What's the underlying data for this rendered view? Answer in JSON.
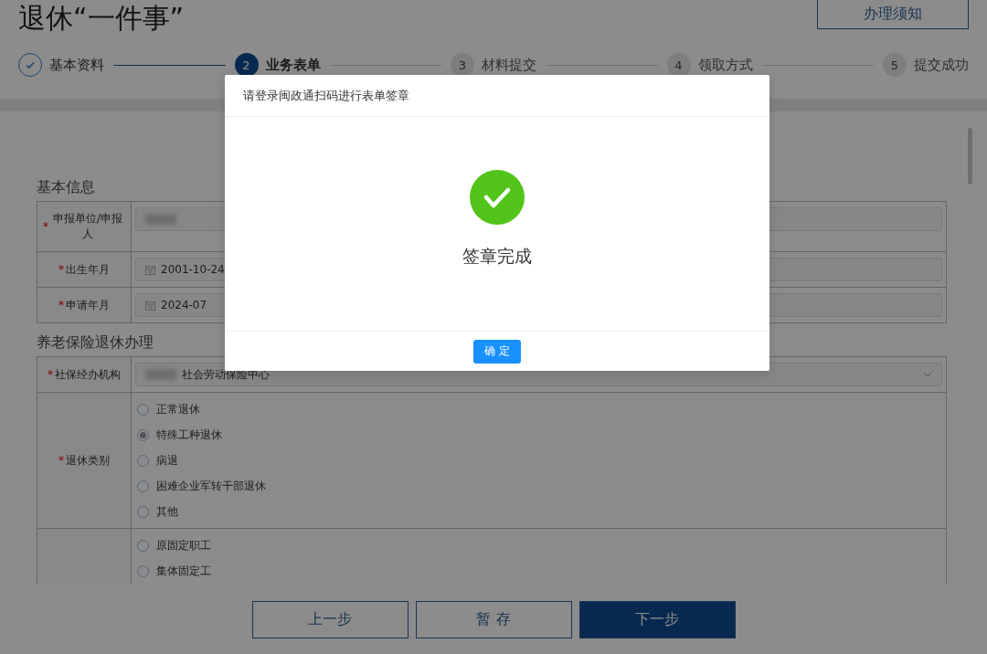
{
  "page": {
    "title": "退休“一件事”",
    "notice_button": "办理须知"
  },
  "steps": [
    {
      "label": "基本资料",
      "done": true,
      "selected": false
    },
    {
      "number": "2",
      "label": "业务表单",
      "done": false,
      "selected": true
    },
    {
      "number": "3",
      "label": "材料提交",
      "done": false,
      "selected": false
    },
    {
      "number": "4",
      "label": "领取方式",
      "done": false,
      "selected": false
    },
    {
      "number": "5",
      "label": "提交成功",
      "done": false,
      "selected": false
    }
  ],
  "sections": [
    {
      "title": "基本信息",
      "rows": [
        {
          "kind": "text",
          "marker": "*",
          "label": "申报单位/申报人",
          "redacted": true,
          "value": ""
        },
        {
          "kind": "date",
          "marker": "*",
          "label": "出生年月",
          "redacted": false,
          "value": "2001-10-24"
        },
        {
          "kind": "date",
          "marker": "*",
          "label": "申请年月",
          "redacted": false,
          "value": "2024-07"
        }
      ]
    },
    {
      "title": "养老保险退休办理",
      "rows": [
        {
          "kind": "select",
          "marker": "*",
          "label": "社保经办机构",
          "redacted": true,
          "value": "社会劳动保险中心"
        },
        {
          "kind": "radio",
          "marker": "*",
          "label": "退休类别",
          "options": [
            {
              "label": "正常退休",
              "selected": false
            },
            {
              "label": "特殊工种退休",
              "selected": true
            },
            {
              "label": "病退",
              "selected": false
            },
            {
              "label": "困难企业军转干部退休",
              "selected": false
            },
            {
              "label": "其他",
              "selected": false
            }
          ]
        },
        {
          "kind": "radio",
          "label": "",
          "options": [
            {
              "label": "原固定职工",
              "selected": false
            },
            {
              "label": "集体固定工",
              "selected": false
            }
          ]
        }
      ]
    }
  ],
  "footer_buttons": [
    {
      "label": "上一步",
      "primary": false
    },
    {
      "label": "暂 存",
      "primary": false
    },
    {
      "label": "下一步",
      "primary": true
    }
  ],
  "modal": {
    "title": "请登录闽政通扫码进行表单签章",
    "message": "签章完成",
    "confirm": "确 定"
  }
}
